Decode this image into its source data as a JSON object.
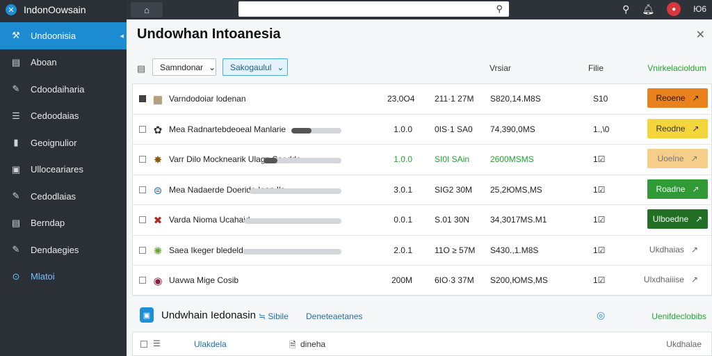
{
  "app": {
    "brand_icon": "x-logo-icon",
    "brand_title": "IndonOowsain"
  },
  "sidebar": {
    "collapse_icon": "chevron-left-icon",
    "items": [
      {
        "label": "Undoonisia",
        "icon": "tools-icon",
        "glyph": "⚒"
      },
      {
        "label": "Aboan",
        "icon": "document-icon",
        "glyph": "▤"
      },
      {
        "label": "Cdoodaiharia",
        "icon": "wrench-icon",
        "glyph": "✎"
      },
      {
        "label": "Cedoodaias",
        "icon": "list-icon",
        "glyph": "☰"
      },
      {
        "label": "Geoignulior",
        "icon": "bars-icon",
        "glyph": "▮"
      },
      {
        "label": "Ulloceariares",
        "icon": "bag-icon",
        "glyph": "▣"
      },
      {
        "label": "Cedodlaias",
        "icon": "wrench-icon",
        "glyph": "✎"
      },
      {
        "label": "Berndap",
        "icon": "book-icon",
        "glyph": "▤"
      },
      {
        "label": "Dendaegies",
        "icon": "wrench-icon",
        "glyph": "✎"
      },
      {
        "label": "Mlatoi",
        "icon": "search-icon",
        "glyph": "⊙"
      }
    ]
  },
  "topbar": {
    "home_icon": "home-icon",
    "search_value": "",
    "search_icon": "search-icon",
    "icons": [
      "search-icon",
      "bell-icon",
      "notification-icon"
    ],
    "user_short": "Ю6"
  },
  "panel": {
    "title": "Undowhan Intoanesia",
    "close_icon": "close-icon"
  },
  "toolbar": {
    "view_icon": "list-view-icon",
    "sort_label": "Samndonar",
    "filter_label": "Sakogaulul",
    "dropdown_icon": "chevron-down-icon"
  },
  "columns": {
    "version": "Vrsiar",
    "file": "Filie",
    "verified": "Vnirkelacioldum"
  },
  "rows": [
    {
      "checked": true,
      "thumb": "▦",
      "thumb_color": "#8a6d2b",
      "name": "Varndodoiar lodenan",
      "progress": null,
      "c1": "23,0O4",
      "c2": "211·1 27M",
      "c3": "S820,14.M8S",
      "c4": "S10",
      "action": "Reoene",
      "style": "orange"
    },
    {
      "checked": false,
      "thumb": "✿",
      "thumb_color": "#333",
      "name": "Mea   Radnartebdeoeal  Manlarie",
      "progress": 0.4,
      "c1": "1.0.0",
      "c2": "0IS·1 SA0",
      "c3": "74,390,0MS",
      "c4": "1.,\\0",
      "action": "Reodne",
      "style": "yellow"
    },
    {
      "checked": false,
      "thumb": "✸",
      "thumb_color": "#8a5a10",
      "name": "Varr   Dilo Mocknearik Ulagn  Saedde",
      "progress": 0.18,
      "c1": "1.0.0",
      "c2": "SI0I SAin",
      "c3": "2600MSMS",
      "c4": "1☑",
      "action": "Uoelne",
      "style": "paleorange",
      "green": true
    },
    {
      "checked": false,
      "thumb": "⊜",
      "thumb_color": "#1c6fb0",
      "name": "Mea   Nadaerde Doeride  Ioan  Ils",
      "progress": 0.0,
      "c1": "3.0.1",
      "c2": "SIG2 30M",
      "c3": "25,2ЮMS,MS",
      "c4": "1☑",
      "action": "Roadne",
      "style": "green"
    },
    {
      "checked": false,
      "thumb": "✖",
      "thumb_color": "#b3261e",
      "name": "Varda   Nioma Ucahaid",
      "progress": 0.0,
      "c1": "0.0.1",
      "c2": "S.01 30N",
      "c3": "34,3017MS.M1",
      "c4": "1☑",
      "action": "Ulboedne",
      "style": "darkgreen"
    },
    {
      "checked": false,
      "thumb": "✺",
      "thumb_color": "#6aa33b",
      "name": "Saea  Ikeger bledeld",
      "progress": 0.0,
      "c1": "2.0.1",
      "c2": "11O ≥ 57M",
      "c3": "S430.,1.M8S",
      "c4": "1☑",
      "action": "Ukdhaias",
      "style": "link"
    },
    {
      "checked": false,
      "thumb": "◉",
      "thumb_color": "#8a1c3d",
      "name": "Uavwa  Mige  Cosib",
      "progress": null,
      "c1": "200M",
      "c2": "6IO·3 37M",
      "c3": "S200,ЮMS,MS",
      "c4": "1☑",
      "action": "Ulxdhaiiise",
      "style": "link"
    }
  ],
  "section": {
    "icon": "package-icon",
    "title": "Undwhain Iedonasin",
    "link1_prefix": "≒",
    "link1": "Sibile",
    "link2": "Deneteaetanes",
    "check_icon": "check-circle-icon",
    "right_label": "Uenifdeclobibs",
    "sub_row": {
      "list_icon": "list-icon",
      "link": "Ulakdela",
      "file_icon": "file-icon",
      "file": "dineha",
      "right": "Ukdhalae"
    }
  }
}
